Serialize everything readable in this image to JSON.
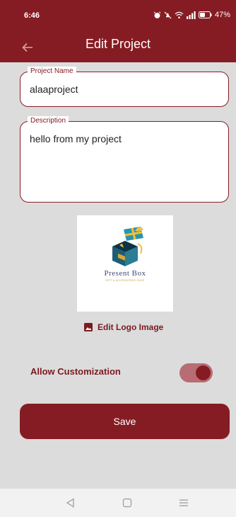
{
  "status_bar": {
    "time": "6:46",
    "battery": "47%",
    "icons": [
      "alarm-icon",
      "mute-icon",
      "wifi-icon",
      "signal-icon",
      "battery-icon"
    ]
  },
  "app_bar": {
    "title": "Edit Project",
    "back_icon": "arrow-back-icon"
  },
  "form": {
    "project_name": {
      "label": "Project Name",
      "value": "alaaproject"
    },
    "description": {
      "label": "Description",
      "value": "hello from my project"
    }
  },
  "logo": {
    "brand_text": "Present Box",
    "sub_text": "GIFT & ACCESSORIES SHOP"
  },
  "edit_logo": {
    "label": "Edit Logo Image",
    "icon": "image-icon"
  },
  "customization": {
    "label": "Allow Customization",
    "enabled": true
  },
  "save_label": "Save",
  "nav_bar": {
    "icons": [
      "back-triangle-icon",
      "home-square-icon",
      "menu-lines-icon"
    ]
  },
  "colors": {
    "primary": "#861c23",
    "toggle_track": "#b86c73",
    "background": "#dcdcdc"
  }
}
